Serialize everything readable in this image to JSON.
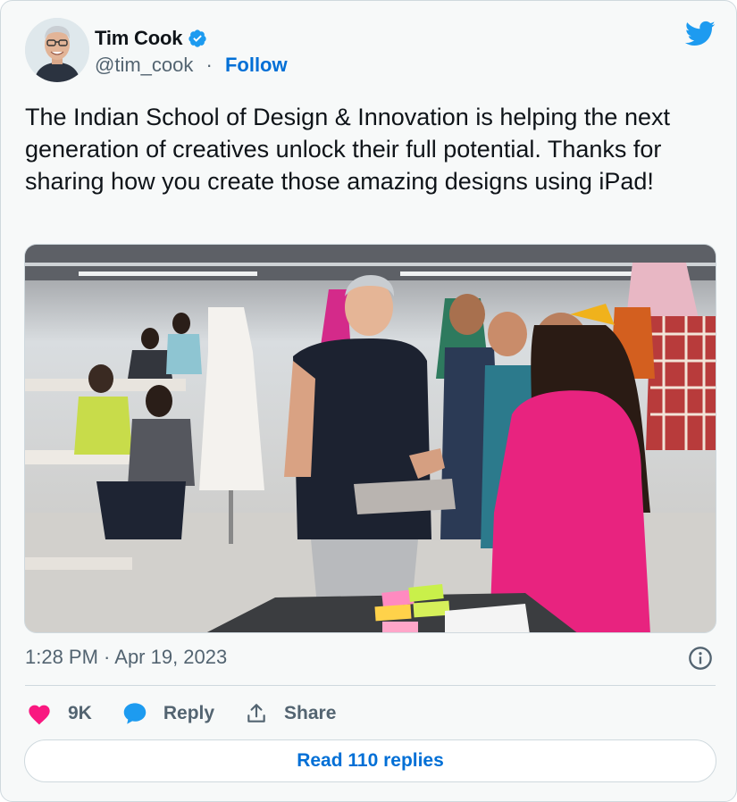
{
  "author": {
    "name": "Tim Cook",
    "handle": "@tim_cook",
    "separator": "·",
    "follow_label": "Follow",
    "verified": true,
    "avatar_icon": "profile-photo"
  },
  "tweet": {
    "text": "The Indian School of Design & Innovation is helping the next generation of creatives unlock their full potential. Thanks for sharing how you create those amazing designs using iPad!",
    "media": "photo"
  },
  "meta": {
    "timestamp": "1:28 PM · Apr 19, 2023"
  },
  "actions": {
    "like_count": "9K",
    "reply_label": "Reply",
    "share_label": "Share"
  },
  "footer": {
    "read_replies_label": "Read 110 replies"
  },
  "colors": {
    "twitter_blue": "#1d9bf0",
    "link_blue": "#006fd6",
    "like_pink": "#f91880",
    "muted_text": "#536471",
    "card_bg": "#f7f9f9",
    "border": "#cfd9de"
  }
}
